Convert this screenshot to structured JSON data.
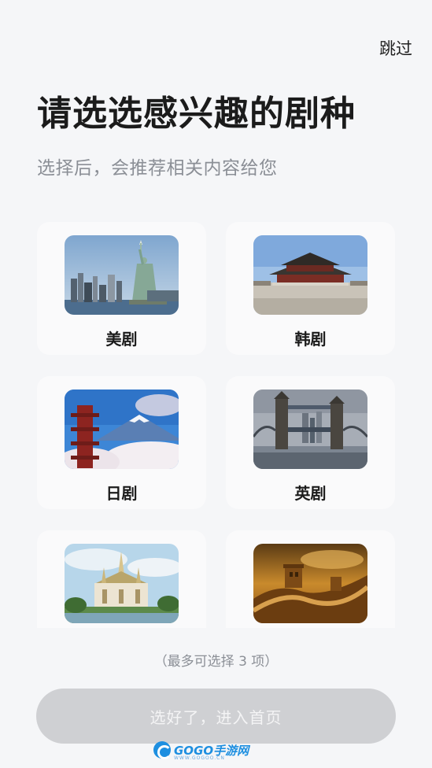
{
  "header": {
    "skip_label": "跳过",
    "title": "请选选感兴趣的剧种",
    "subtitle": "选择后，会推荐相关内容给您"
  },
  "genres": [
    {
      "label": "美剧",
      "image_icon": "statue-of-liberty-skyline"
    },
    {
      "label": "韩剧",
      "image_icon": "korean-palace"
    },
    {
      "label": "日剧",
      "image_icon": "mount-fuji-pagoda"
    },
    {
      "label": "英剧",
      "image_icon": "tower-bridge"
    },
    {
      "label": "",
      "image_icon": "thai-temple"
    },
    {
      "label": "",
      "image_icon": "great-wall"
    }
  ],
  "footer": {
    "hint": "（最多可选择 3 项）",
    "confirm_label": "选好了，进入首页"
  },
  "watermark": {
    "brand": "GOGO手游网",
    "url": "WWW.GOGOO.CN"
  },
  "colors": {
    "background": "#f5f6f8",
    "card": "#fafafb",
    "button_disabled": "#cfd0d3",
    "subtitle": "#8b8f96"
  }
}
